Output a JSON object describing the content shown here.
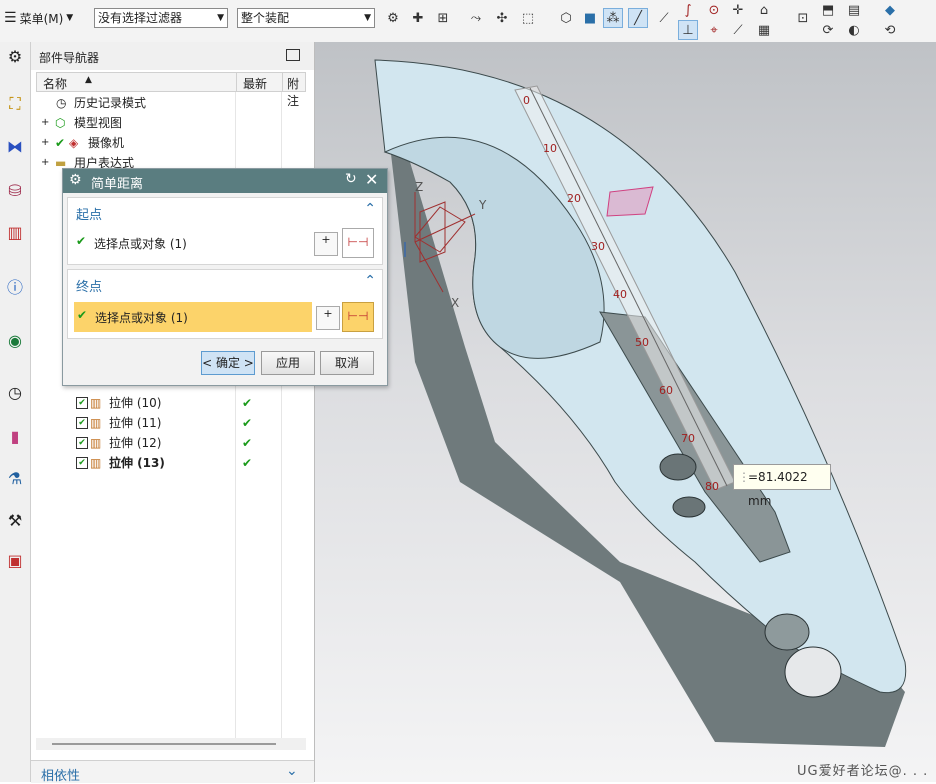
{
  "toolbar": {
    "menu_label": "菜单(M)",
    "filter_select": "没有选择过滤器",
    "assembly_select": "整个装配"
  },
  "navigator": {
    "title": "部件导航器",
    "columns": [
      "名称",
      "最新",
      "附注"
    ],
    "tree_top": [
      {
        "label": "历史记录模式"
      },
      {
        "label": "模型视图"
      },
      {
        "label": "摄像机"
      },
      {
        "label": "用户表达式"
      }
    ],
    "features": [
      {
        "label": "拉伸 (10)",
        "latest": "✔"
      },
      {
        "label": "拉伸 (11)",
        "latest": "✔"
      },
      {
        "label": "拉伸 (12)",
        "latest": "✔"
      },
      {
        "label": "拉伸 (13)",
        "latest": "✔"
      }
    ],
    "dependency_label": "相依性"
  },
  "dialog": {
    "title": "简单距离",
    "start_section": "起点",
    "start_select": "选择点或对象 (1)",
    "end_section": "终点",
    "end_select": "选择点或对象 (1)",
    "ok_label": "< 确定 >",
    "apply_label": "应用",
    "cancel_label": "取消"
  },
  "viewport": {
    "measurement": "=81.4022 mm",
    "ruler_ticks": [
      "0",
      "10",
      "20",
      "30",
      "40",
      "50",
      "60",
      "70",
      "80"
    ],
    "axis_x": "X",
    "axis_y": "Y",
    "axis_z": "Z",
    "watermark": "UG爱好者论坛@. . ."
  },
  "colors": {
    "dialog_title_bg": "#5a7d80",
    "highlight_row": "#fcd36a",
    "part_face": "#d2e6ef",
    "part_side": "#6f7a7c",
    "section_title": "#2a6fa8"
  }
}
